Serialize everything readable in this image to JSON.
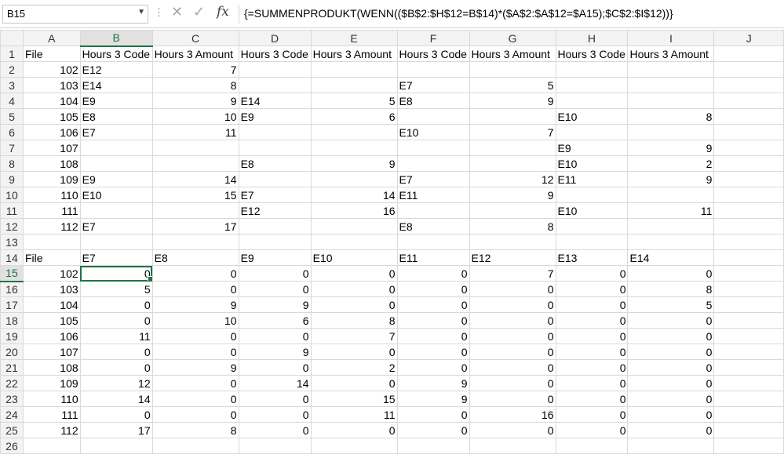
{
  "formula_bar": {
    "name_box": "B15",
    "formula": "{=SUMMENPRODUKT(WENN(($B$2:$H$12=B$14)*($A$2:$A$12=$A15);$C$2:$I$12))}",
    "fx_label": "fx"
  },
  "columns": [
    "A",
    "B",
    "C",
    "D",
    "E",
    "F",
    "G",
    "H",
    "I",
    "J"
  ],
  "selected_column": "B",
  "selected_row": 15,
  "active_cell": "B15",
  "rows": [
    {
      "n": 1,
      "cells": [
        "File",
        "Hours 3 Code",
        "Hours 3 Amount",
        "Hours 3 Code",
        "Hours 3 Amount",
        "Hours 3 Code",
        "Hours 3 Amount",
        "Hours 3 Code",
        "Hours 3 Amount",
        ""
      ]
    },
    {
      "n": 2,
      "cells": [
        "102",
        "E12",
        "7",
        "",
        "",
        "",
        "",
        "",
        "",
        ""
      ]
    },
    {
      "n": 3,
      "cells": [
        "103",
        "E14",
        "8",
        "",
        "",
        "E7",
        "5",
        "",
        "",
        ""
      ]
    },
    {
      "n": 4,
      "cells": [
        "104",
        "E9",
        "9",
        "E14",
        "5",
        "E8",
        "9",
        "",
        "",
        ""
      ]
    },
    {
      "n": 5,
      "cells": [
        "105",
        "E8",
        "10",
        "E9",
        "6",
        "",
        "",
        "E10",
        "8",
        ""
      ]
    },
    {
      "n": 6,
      "cells": [
        "106",
        "E7",
        "11",
        "",
        "",
        "E10",
        "7",
        "",
        "",
        ""
      ]
    },
    {
      "n": 7,
      "cells": [
        "107",
        "",
        "",
        "",
        "",
        "",
        "",
        "E9",
        "9",
        ""
      ]
    },
    {
      "n": 8,
      "cells": [
        "108",
        "",
        "",
        "E8",
        "9",
        "",
        "",
        "E10",
        "2",
        ""
      ]
    },
    {
      "n": 9,
      "cells": [
        "109",
        "E9",
        "14",
        "",
        "",
        "E7",
        "12",
        "E11",
        "9",
        ""
      ]
    },
    {
      "n": 10,
      "cells": [
        "110",
        "E10",
        "15",
        "E7",
        "14",
        "E11",
        "9",
        "",
        "",
        ""
      ]
    },
    {
      "n": 11,
      "cells": [
        "111",
        "",
        "",
        "E12",
        "16",
        "",
        "",
        "E10",
        "11",
        ""
      ]
    },
    {
      "n": 12,
      "cells": [
        "112",
        "E7",
        "17",
        "",
        "",
        "E8",
        "8",
        "",
        "",
        ""
      ]
    },
    {
      "n": 13,
      "cells": [
        "",
        "",
        "",
        "",
        "",
        "",
        "",
        "",
        "",
        ""
      ]
    },
    {
      "n": 14,
      "cells": [
        "File",
        "E7",
        "E8",
        "E9",
        "E10",
        "E11",
        "E12",
        "E13",
        "E14",
        ""
      ]
    },
    {
      "n": 15,
      "cells": [
        "102",
        "0",
        "0",
        "0",
        "0",
        "0",
        "7",
        "0",
        "0",
        ""
      ]
    },
    {
      "n": 16,
      "cells": [
        "103",
        "5",
        "0",
        "0",
        "0",
        "0",
        "0",
        "0",
        "8",
        ""
      ]
    },
    {
      "n": 17,
      "cells": [
        "104",
        "0",
        "9",
        "9",
        "0",
        "0",
        "0",
        "0",
        "5",
        ""
      ]
    },
    {
      "n": 18,
      "cells": [
        "105",
        "0",
        "10",
        "6",
        "8",
        "0",
        "0",
        "0",
        "0",
        ""
      ]
    },
    {
      "n": 19,
      "cells": [
        "106",
        "11",
        "0",
        "0",
        "7",
        "0",
        "0",
        "0",
        "0",
        ""
      ]
    },
    {
      "n": 20,
      "cells": [
        "107",
        "0",
        "0",
        "9",
        "0",
        "0",
        "0",
        "0",
        "0",
        ""
      ]
    },
    {
      "n": 21,
      "cells": [
        "108",
        "0",
        "9",
        "0",
        "2",
        "0",
        "0",
        "0",
        "0",
        ""
      ]
    },
    {
      "n": 22,
      "cells": [
        "109",
        "12",
        "0",
        "14",
        "0",
        "9",
        "0",
        "0",
        "0",
        ""
      ]
    },
    {
      "n": 23,
      "cells": [
        "110",
        "14",
        "0",
        "0",
        "15",
        "9",
        "0",
        "0",
        "0",
        ""
      ]
    },
    {
      "n": 24,
      "cells": [
        "111",
        "0",
        "0",
        "0",
        "11",
        "0",
        "16",
        "0",
        "0",
        ""
      ]
    },
    {
      "n": 25,
      "cells": [
        "112",
        "17",
        "8",
        "0",
        "0",
        "0",
        "0",
        "0",
        "0",
        ""
      ]
    },
    {
      "n": 26,
      "cells": [
        "",
        "",
        "",
        "",
        "",
        "",
        "",
        "",
        "",
        ""
      ]
    }
  ],
  "icons": {
    "cancel": "close-icon",
    "confirm": "check-icon",
    "function": "fx-icon",
    "dropdown": "chevron-down-icon"
  },
  "colors": {
    "accent": "#217346",
    "header_bg": "#f3f3f3",
    "gridline": "#d9d9d9"
  }
}
